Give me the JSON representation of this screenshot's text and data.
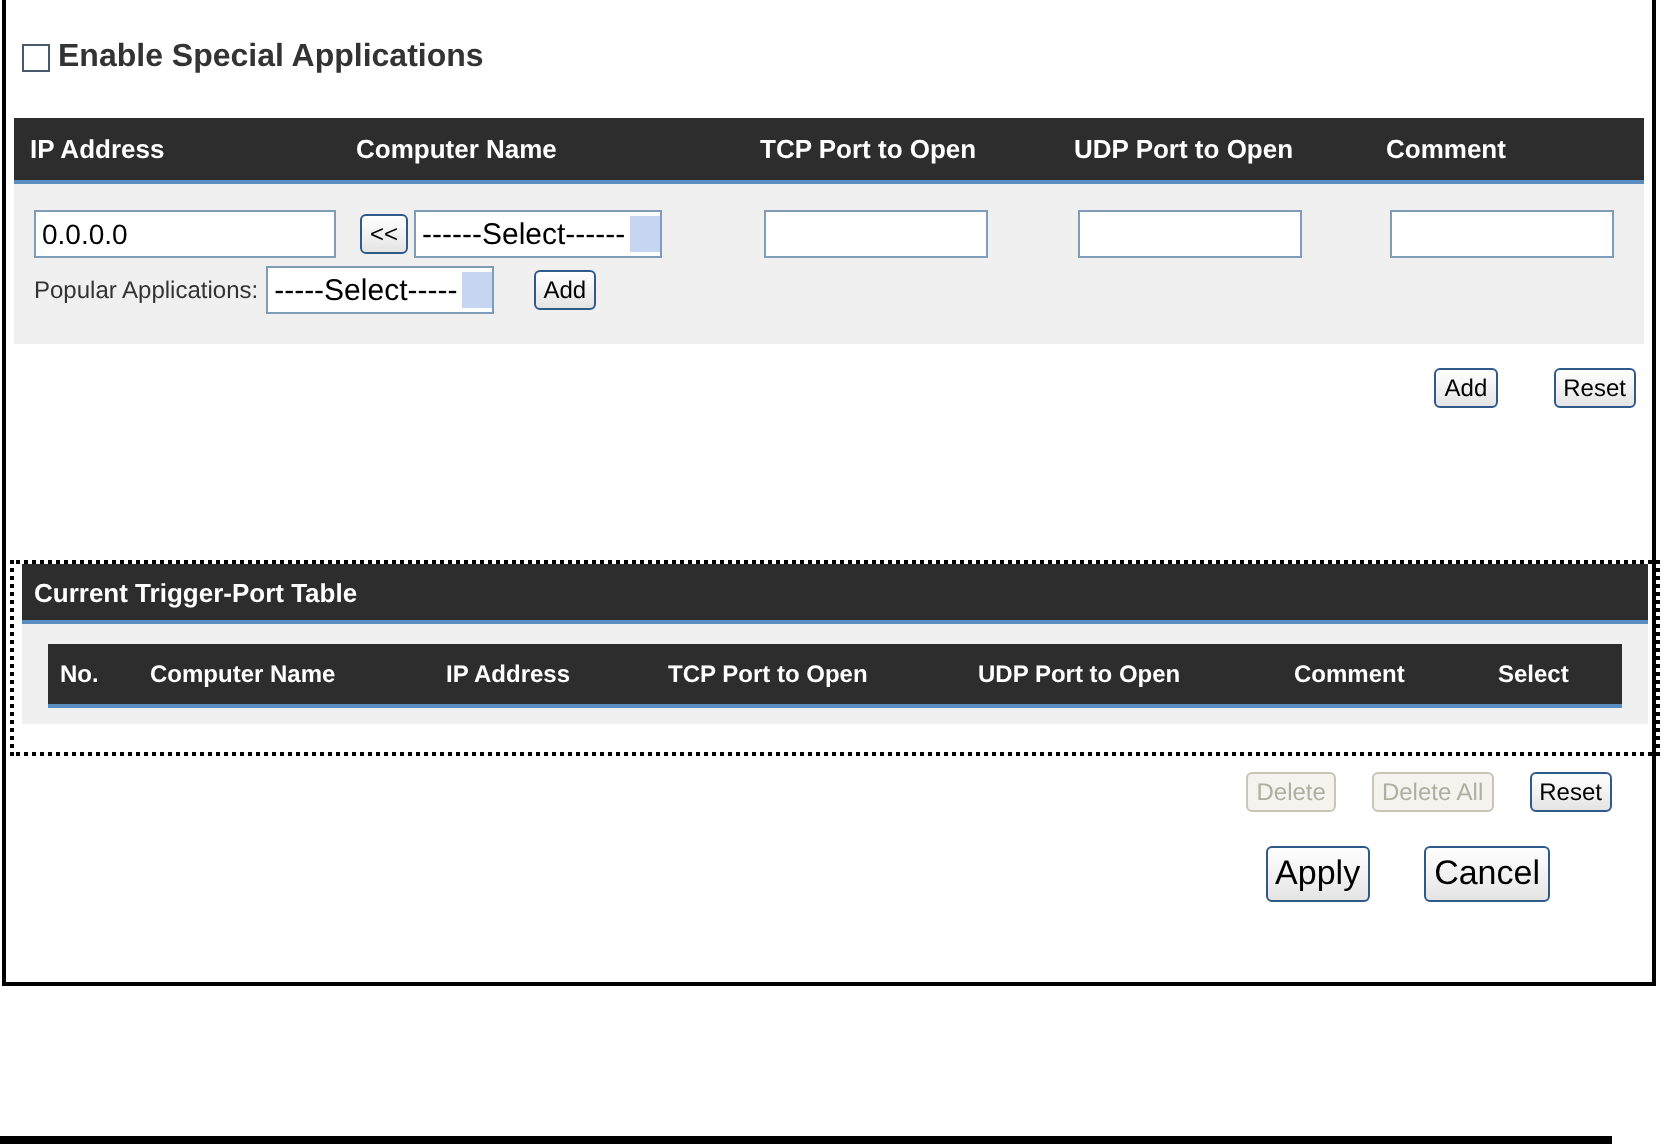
{
  "enable": {
    "label": "Enable Special Applications",
    "checked": false
  },
  "form": {
    "columns": [
      "IP Address",
      "Computer Name",
      "TCP Port to Open",
      "UDP Port to Open",
      "Comment"
    ],
    "ip_value": "0.0.0.0",
    "copy_button": "<<",
    "computer_select": "------Select------",
    "popular_label": "Popular Applications:",
    "popular_select": "-----Select-----",
    "popular_add": "Add"
  },
  "form_buttons": [
    {
      "label": "Add",
      "disabled": false
    },
    {
      "label": "Reset",
      "disabled": false
    }
  ],
  "trigger_table": {
    "title": "Current Trigger-Port Table",
    "columns": [
      "No.",
      "Computer Name",
      "IP Address",
      "TCP Port to Open",
      "UDP Port to Open",
      "Comment",
      "Select"
    ]
  },
  "table_buttons": [
    {
      "label": "Delete",
      "disabled": true
    },
    {
      "label": "Delete All",
      "disabled": true
    },
    {
      "label": "Reset",
      "disabled": false
    }
  ],
  "footer_buttons": [
    {
      "label": "Apply"
    },
    {
      "label": "Cancel"
    }
  ]
}
